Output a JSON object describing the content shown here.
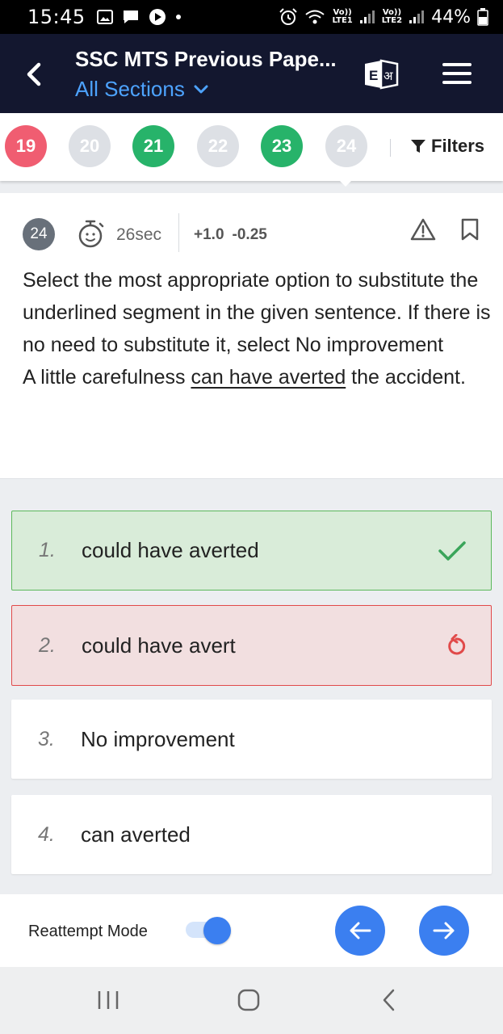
{
  "status_bar": {
    "time": "15:45",
    "net1_top": "Vo))",
    "net1_bottom": "LTE1",
    "net2_top": "Vo))",
    "net2_bottom": "LTE2",
    "battery": "44%"
  },
  "app_bar": {
    "title": "SSC MTS Previous Pape...",
    "section": "All Sections",
    "lang_en": "E",
    "lang_hi": "अ"
  },
  "question_strip": {
    "items": [
      {
        "number": "19",
        "status": "wrong"
      },
      {
        "number": "20",
        "status": "unattempted"
      },
      {
        "number": "21",
        "status": "correct"
      },
      {
        "number": "22",
        "status": "unattempted"
      },
      {
        "number": "23",
        "status": "correct"
      },
      {
        "number": "24",
        "status": "current"
      }
    ],
    "filters_label": "Filters"
  },
  "question": {
    "number": "24",
    "time": "26sec",
    "positive_marks": "+1.0",
    "negative_marks": "-0.25",
    "text_intro": "Select the most appropriate option to substitute the underlined segment in the given sentence. If there is no need to substitute it, select No improvement",
    "sentence_before": "A little carefulness ",
    "sentence_underlined": "can have averted",
    "sentence_after": " the accident."
  },
  "options": [
    {
      "number": "1.",
      "text": "could have averted",
      "state": "correct"
    },
    {
      "number": "2.",
      "text": "could have avert",
      "state": "wrong"
    },
    {
      "number": "3.",
      "text": "No improvement",
      "state": "neutral"
    },
    {
      "number": "4.",
      "text": "can averted",
      "state": "neutral"
    }
  ],
  "controls": {
    "reattempt_label": "Reattempt Mode",
    "reattempt_on": true
  },
  "colors": {
    "appbar": "#13172f",
    "accent_blue": "#3b7ff0",
    "correct_green": "#27b36a",
    "wrong_red": "#f05d71"
  }
}
